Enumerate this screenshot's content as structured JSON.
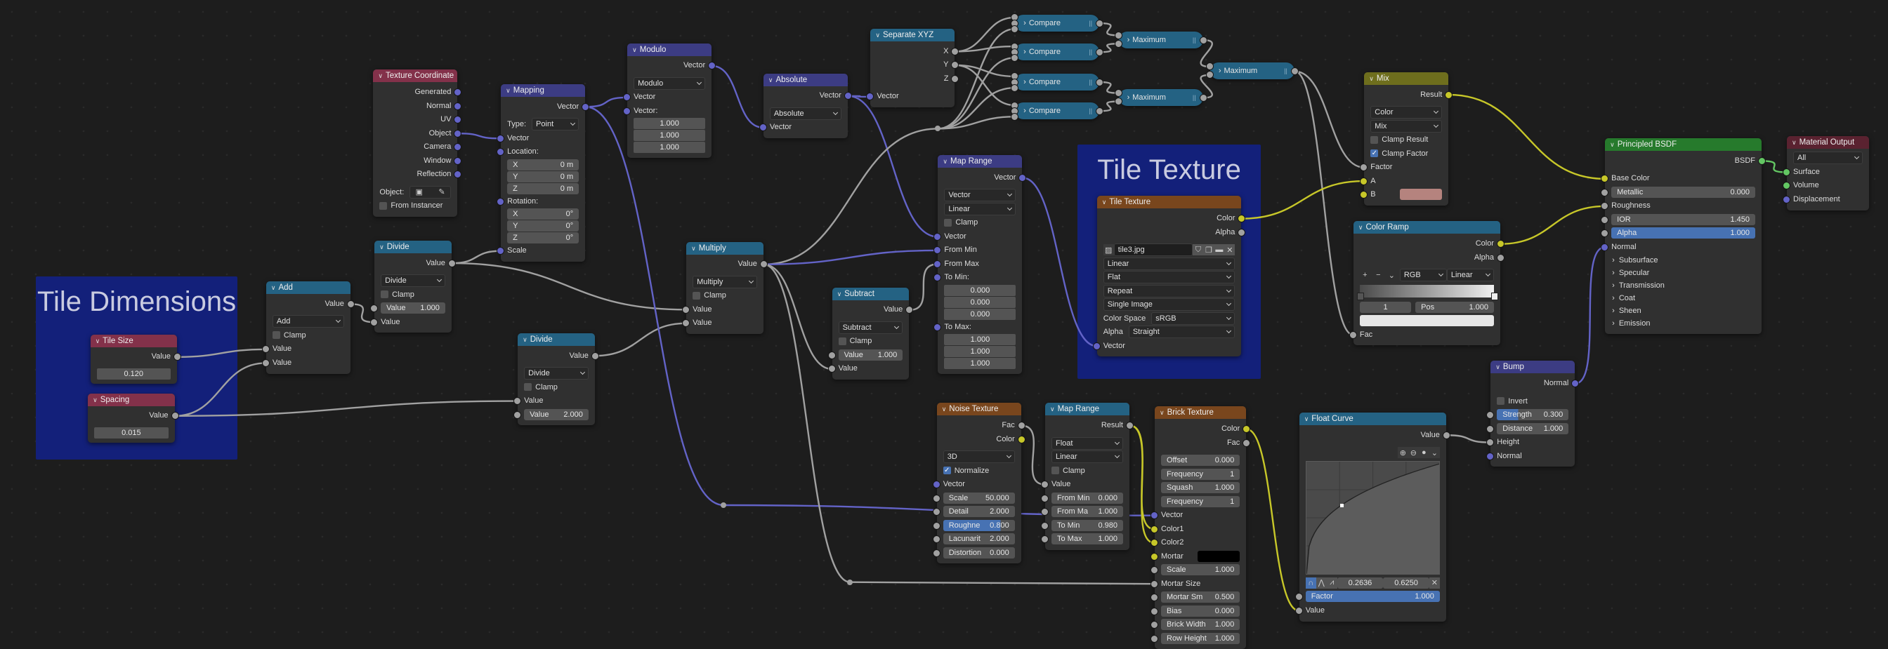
{
  "frames": [
    {
      "id": "tile-dimensions",
      "label": "Tile Dimensions"
    },
    {
      "id": "tile-texture-frame",
      "label": "Tile Texture"
    }
  ],
  "nodes": [
    {
      "id": "tilesize",
      "title": "Tile Size",
      "color": "#83314a",
      "rows": [
        {
          "t": "out",
          "label": "Value",
          "s": "float"
        },
        {
          "t": "vec",
          "value": "0.120"
        }
      ]
    },
    {
      "id": "spacing",
      "title": "Spacing",
      "color": "#83314a",
      "rows": [
        {
          "t": "out",
          "label": "Value",
          "s": "float"
        },
        {
          "t": "vec",
          "value": "0.015"
        }
      ]
    },
    {
      "id": "add",
      "title": "Add",
      "color": "#246283",
      "rows": [
        {
          "t": "out",
          "label": "Value",
          "s": "float"
        },
        {
          "t": "select",
          "value": "Add"
        },
        {
          "t": "check",
          "label": "Clamp",
          "checked": false
        },
        {
          "t": "in",
          "label": "Value",
          "s": "float"
        },
        {
          "t": "in",
          "label": "Value",
          "s": "float"
        }
      ]
    },
    {
      "id": "divide1",
      "title": "Divide",
      "color": "#246283",
      "rows": [
        {
          "t": "out",
          "label": "Value",
          "s": "float"
        },
        {
          "t": "select",
          "value": "Divide"
        },
        {
          "t": "check",
          "label": "Clamp",
          "checked": false
        },
        {
          "t": "field",
          "label": "Value",
          "value": "1.000",
          "s": "float"
        },
        {
          "t": "in",
          "label": "Value",
          "s": "float"
        }
      ]
    },
    {
      "id": "divide2",
      "title": "Divide",
      "color": "#246283",
      "rows": [
        {
          "t": "out",
          "label": "Value",
          "s": "float"
        },
        {
          "t": "select",
          "value": "Divide"
        },
        {
          "t": "check",
          "label": "Clamp",
          "checked": false
        },
        {
          "t": "in",
          "label": "Value",
          "s": "float"
        },
        {
          "t": "field",
          "label": "Value",
          "value": "2.000",
          "s": "float"
        }
      ]
    },
    {
      "id": "texcoord",
      "title": "Texture Coordinate",
      "color": "#83314a",
      "rows": [
        {
          "t": "out",
          "label": "Generated",
          "s": "vector"
        },
        {
          "t": "out",
          "label": "Normal",
          "s": "vector"
        },
        {
          "t": "out",
          "label": "UV",
          "s": "vector"
        },
        {
          "t": "out",
          "label": "Object",
          "s": "vector"
        },
        {
          "t": "out",
          "label": "Camera",
          "s": "vector"
        },
        {
          "t": "out",
          "label": "Window",
          "s": "vector"
        },
        {
          "t": "out",
          "label": "Reflection",
          "s": "vector"
        },
        {
          "t": "objpick",
          "label": "Object:"
        },
        {
          "t": "check",
          "label": "From Instancer",
          "checked": false
        }
      ]
    },
    {
      "id": "mapping",
      "title": "Mapping",
      "color": "#3c3c83",
      "rows": [
        {
          "t": "out",
          "label": "Vector",
          "s": "vector"
        },
        {
          "t": "select",
          "label": "Type:",
          "value": "Point"
        },
        {
          "t": "in",
          "label": "Vector",
          "s": "vector"
        },
        {
          "t": "in",
          "label": "Location:",
          "s": "vector"
        },
        {
          "t": "field",
          "label": "X",
          "value": "0 m",
          "v": 1
        },
        {
          "t": "field",
          "label": "Y",
          "value": "0 m",
          "v": 1
        },
        {
          "t": "field",
          "label": "Z",
          "value": "0 m",
          "v": 1
        },
        {
          "t": "in",
          "label": "Rotation:",
          "s": "vector"
        },
        {
          "t": "field",
          "label": "X",
          "value": "0°",
          "v": 1
        },
        {
          "t": "field",
          "label": "Y",
          "value": "0°",
          "v": 1
        },
        {
          "t": "field",
          "label": "Z",
          "value": "0°",
          "v": 1
        },
        {
          "t": "in",
          "label": "Scale",
          "s": "vector"
        }
      ]
    },
    {
      "id": "modulo",
      "title": "Modulo",
      "color": "#3c3c83",
      "rows": [
        {
          "t": "out",
          "label": "Vector",
          "s": "vector"
        },
        {
          "t": "select",
          "value": "Modulo"
        },
        {
          "t": "in",
          "label": "Vector",
          "s": "vector"
        },
        {
          "t": "in",
          "label": "Vector:",
          "s": "vector"
        },
        {
          "t": "vec",
          "value": "1.000"
        },
        {
          "t": "vec",
          "value": "1.000"
        },
        {
          "t": "vec",
          "value": "1.000"
        }
      ]
    },
    {
      "id": "absolute",
      "title": "Absolute",
      "color": "#3c3c83",
      "rows": [
        {
          "t": "out",
          "label": "Vector",
          "s": "vector"
        },
        {
          "t": "select",
          "value": "Absolute"
        },
        {
          "t": "in",
          "label": "Vector",
          "s": "vector"
        }
      ]
    },
    {
      "id": "sepxyz",
      "title": "Separate XYZ",
      "color": "#246283",
      "rows": [
        {
          "t": "out",
          "label": "X",
          "s": "float"
        },
        {
          "t": "out",
          "label": "Y",
          "s": "float"
        },
        {
          "t": "out",
          "label": "Z",
          "s": "float"
        },
        {
          "t": "in",
          "label": "Vector",
          "s": "vector"
        }
      ]
    },
    {
      "id": "compare1",
      "title": "Compare",
      "color": "#246283",
      "collapsed": true,
      "inputs": 3
    },
    {
      "id": "compare2",
      "title": "Compare",
      "color": "#246283",
      "collapsed": true,
      "inputs": 3
    },
    {
      "id": "compare3",
      "title": "Compare",
      "color": "#246283",
      "collapsed": true,
      "inputs": 3
    },
    {
      "id": "compare4",
      "title": "Compare",
      "color": "#246283",
      "collapsed": true,
      "inputs": 3
    },
    {
      "id": "max1",
      "title": "Maximum",
      "color": "#246283",
      "collapsed": true,
      "inputs": 2
    },
    {
      "id": "max2",
      "title": "Maximum",
      "color": "#246283",
      "collapsed": true,
      "inputs": 2
    },
    {
      "id": "max3",
      "title": "Maximum",
      "color": "#246283",
      "collapsed": true,
      "inputs": 2
    },
    {
      "id": "maprange1",
      "title": "Map Range",
      "color": "#3c3c83",
      "rows": [
        {
          "t": "out",
          "label": "Vector",
          "s": "vector"
        },
        {
          "t": "select",
          "value": "Vector"
        },
        {
          "t": "select",
          "value": "Linear"
        },
        {
          "t": "check",
          "label": "Clamp",
          "checked": false
        },
        {
          "t": "in",
          "label": "Vector",
          "s": "vector"
        },
        {
          "t": "in",
          "label": "From Min",
          "s": "vector"
        },
        {
          "t": "in",
          "label": "From Max",
          "s": "vector"
        },
        {
          "t": "in",
          "label": "To Min:",
          "s": "vector"
        },
        {
          "t": "vec",
          "value": "0.000"
        },
        {
          "t": "vec",
          "value": "0.000"
        },
        {
          "t": "vec",
          "value": "0.000"
        },
        {
          "t": "in",
          "label": "To Max:",
          "s": "vector"
        },
        {
          "t": "vec",
          "value": "1.000"
        },
        {
          "t": "vec",
          "value": "1.000"
        },
        {
          "t": "vec",
          "value": "1.000"
        }
      ]
    },
    {
      "id": "multiply",
      "title": "Multiply",
      "color": "#246283",
      "rows": [
        {
          "t": "out",
          "label": "Value",
          "s": "float"
        },
        {
          "t": "select",
          "value": "Multiply"
        },
        {
          "t": "check",
          "label": "Clamp",
          "checked": false
        },
        {
          "t": "in",
          "label": "Value",
          "s": "float"
        },
        {
          "t": "in",
          "label": "Value",
          "s": "float"
        }
      ]
    },
    {
      "id": "subtract",
      "title": "Subtract",
      "color": "#246283",
      "rows": [
        {
          "t": "out",
          "label": "Value",
          "s": "float"
        },
        {
          "t": "select",
          "value": "Subtract"
        },
        {
          "t": "check",
          "label": "Clamp",
          "checked": false
        },
        {
          "t": "field",
          "label": "Value",
          "value": "1.000",
          "s": "float"
        },
        {
          "t": "in",
          "label": "Value",
          "s": "float"
        }
      ]
    },
    {
      "id": "tiletex",
      "title": "Tile Texture",
      "color": "#79461d",
      "rows": [
        {
          "t": "out",
          "label": "Color",
          "s": "color"
        },
        {
          "t": "out",
          "label": "Alpha",
          "s": "float"
        },
        {
          "t": "image",
          "value": "tile3.jpg"
        },
        {
          "t": "select",
          "value": "Linear"
        },
        {
          "t": "select",
          "value": "Flat"
        },
        {
          "t": "select",
          "value": "Repeat"
        },
        {
          "t": "select",
          "value": "Single Image"
        },
        {
          "t": "select",
          "label": "Color Space",
          "value": "sRGB"
        },
        {
          "t": "select",
          "label": "Alpha",
          "value": "Straight"
        },
        {
          "t": "in",
          "label": "Vector",
          "s": "vector"
        }
      ]
    },
    {
      "id": "mix",
      "title": "Mix",
      "color": "#6e6e1d",
      "rows": [
        {
          "t": "out",
          "label": "Result",
          "s": "color"
        },
        {
          "t": "select",
          "value": "Color"
        },
        {
          "t": "select",
          "value": "Mix"
        },
        {
          "t": "check",
          "label": "Clamp Result",
          "checked": false
        },
        {
          "t": "check",
          "label": "Clamp Factor",
          "checked": true
        },
        {
          "t": "in",
          "label": "Factor",
          "s": "float"
        },
        {
          "t": "in",
          "label": "A",
          "s": "color"
        },
        {
          "t": "swatch",
          "label": "B",
          "s": "color",
          "color": "#b5837e"
        }
      ]
    },
    {
      "id": "colorramp",
      "title": "Color Ramp",
      "color": "#246283",
      "rows": [
        {
          "t": "out",
          "label": "Color",
          "s": "color"
        },
        {
          "t": "out",
          "label": "Alpha",
          "s": "float"
        },
        {
          "t": "rampctl",
          "mode": "RGB",
          "interp": "Linear"
        },
        {
          "t": "rampbar"
        },
        {
          "t": "ramppos",
          "index": "1",
          "label": "Pos",
          "value": "1.000"
        },
        {
          "t": "rampcolor",
          "color": "#e6e6e6"
        },
        {
          "t": "in",
          "label": "Fac",
          "s": "float"
        }
      ]
    },
    {
      "id": "bsdf",
      "title": "Principled BSDF",
      "color": "#267a2c",
      "rows": [
        {
          "t": "out",
          "label": "BSDF",
          "s": "shader"
        },
        {
          "t": "in",
          "label": "Base Color",
          "s": "color"
        },
        {
          "t": "field",
          "label": "Metallic",
          "value": "0.000",
          "s": "float"
        },
        {
          "t": "in",
          "label": "Roughness",
          "s": "float"
        },
        {
          "t": "field",
          "label": "IOR",
          "value": "1.450",
          "s": "float"
        },
        {
          "t": "field",
          "label": "Alpha",
          "value": "1.000",
          "s": "float",
          "fill": 1.0
        },
        {
          "t": "in",
          "label": "Normal",
          "s": "vector"
        },
        {
          "t": "panel",
          "label": "Subsurface"
        },
        {
          "t": "panel",
          "label": "Specular"
        },
        {
          "t": "panel",
          "label": "Transmission"
        },
        {
          "t": "panel",
          "label": "Coat"
        },
        {
          "t": "panel",
          "label": "Sheen"
        },
        {
          "t": "panel",
          "label": "Emission"
        }
      ]
    },
    {
      "id": "matout",
      "title": "Material Output",
      "color": "#5a2230",
      "rows": [
        {
          "t": "select",
          "value": "All"
        },
        {
          "t": "in",
          "label": "Surface",
          "s": "shader"
        },
        {
          "t": "in",
          "label": "Volume",
          "s": "shader"
        },
        {
          "t": "in",
          "label": "Displacement",
          "s": "vector"
        }
      ]
    },
    {
      "id": "noise",
      "title": "Noise Texture",
      "color": "#79461d",
      "rows": [
        {
          "t": "out",
          "label": "Fac",
          "s": "float"
        },
        {
          "t": "out",
          "label": "Color",
          "s": "color"
        },
        {
          "t": "select",
          "value": "3D"
        },
        {
          "t": "check",
          "label": "Normalize",
          "checked": true
        },
        {
          "t": "in",
          "label": "Vector",
          "s": "vector"
        },
        {
          "t": "field",
          "label": "Scale",
          "value": "50.000",
          "s": "float"
        },
        {
          "t": "field",
          "label": "Detail",
          "value": "2.000",
          "s": "float"
        },
        {
          "t": "field",
          "label": "Roughne",
          "value": "0.800",
          "s": "float",
          "fill": 0.8
        },
        {
          "t": "field",
          "label": "Lacunarit",
          "value": "2.000",
          "s": "float"
        },
        {
          "t": "field",
          "label": "Distortion",
          "value": "0.000",
          "s": "float"
        }
      ]
    },
    {
      "id": "maprange2",
      "title": "Map Range",
      "color": "#246283",
      "rows": [
        {
          "t": "out",
          "label": "Result",
          "s": "float"
        },
        {
          "t": "select",
          "value": "Float"
        },
        {
          "t": "select",
          "value": "Linear"
        },
        {
          "t": "check",
          "label": "Clamp",
          "checked": false
        },
        {
          "t": "in",
          "label": "Value",
          "s": "float"
        },
        {
          "t": "field",
          "label": "From Min",
          "value": "0.000",
          "s": "float"
        },
        {
          "t": "field",
          "label": "From Ma",
          "value": "1.000",
          "s": "float"
        },
        {
          "t": "field",
          "label": "To Min",
          "value": "0.980",
          "s": "float"
        },
        {
          "t": "field",
          "label": "To Max",
          "value": "1.000",
          "s": "float"
        }
      ]
    },
    {
      "id": "brick",
      "title": "Brick Texture",
      "color": "#79461d",
      "rows": [
        {
          "t": "out",
          "label": "Color",
          "s": "color"
        },
        {
          "t": "out",
          "label": "Fac",
          "s": "float"
        },
        {
          "t": "field",
          "label": "Offset",
          "value": "0.000"
        },
        {
          "t": "field",
          "label": "Frequency",
          "value": "1"
        },
        {
          "t": "field",
          "label": "Squash",
          "value": "1.000"
        },
        {
          "t": "field",
          "label": "Frequency",
          "value": "1"
        },
        {
          "t": "in",
          "label": "Vector",
          "s": "vector"
        },
        {
          "t": "in",
          "label": "Color1",
          "s": "color"
        },
        {
          "t": "in",
          "label": "Color2",
          "s": "color"
        },
        {
          "t": "swatch",
          "label": "Mortar",
          "s": "color",
          "color": "#000000"
        },
        {
          "t": "field",
          "label": "Scale",
          "value": "1.000",
          "s": "float"
        },
        {
          "t": "in",
          "label": "Mortar Size",
          "s": "float"
        },
        {
          "t": "field",
          "label": "Mortar Sm",
          "value": "0.500",
          "s": "float"
        },
        {
          "t": "field",
          "label": "Bias",
          "value": "0.000",
          "s": "float"
        },
        {
          "t": "field",
          "label": "Brick Width",
          "value": "1.000",
          "s": "float"
        },
        {
          "t": "field",
          "label": "Row Height",
          "value": "1.000",
          "s": "float"
        }
      ]
    },
    {
      "id": "floatcurve",
      "title": "Float Curve",
      "color": "#246283",
      "rows": [
        {
          "t": "out",
          "label": "Value",
          "s": "float"
        },
        {
          "t": "curvetools"
        },
        {
          "t": "curve",
          "point": [
            0.2636,
            0.625
          ]
        },
        {
          "t": "curvevals",
          "x": "0.2636",
          "y": "0.6250"
        },
        {
          "t": "field",
          "label": "Factor",
          "value": "1.000",
          "s": "float",
          "fill": 1.0
        },
        {
          "t": "in",
          "label": "Value",
          "s": "float"
        }
      ]
    },
    {
      "id": "bump",
      "title": "Bump",
      "color": "#3c3c83",
      "rows": [
        {
          "t": "out",
          "label": "Normal",
          "s": "vector"
        },
        {
          "t": "check",
          "label": "Invert",
          "checked": false
        },
        {
          "t": "field",
          "label": "Strength",
          "value": "0.300",
          "s": "float",
          "fill": 0.3
        },
        {
          "t": "field",
          "label": "Distance",
          "value": "1.000",
          "s": "float"
        },
        {
          "t": "in",
          "label": "Height",
          "s": "float"
        },
        {
          "t": "in",
          "label": "Normal",
          "s": "vector"
        }
      ]
    }
  ],
  "socket_colors": {
    "float": "#a1a1a1",
    "vector": "#6363c7",
    "color": "#c7c729",
    "shader": "#63c763"
  },
  "accent": "#4772b3"
}
